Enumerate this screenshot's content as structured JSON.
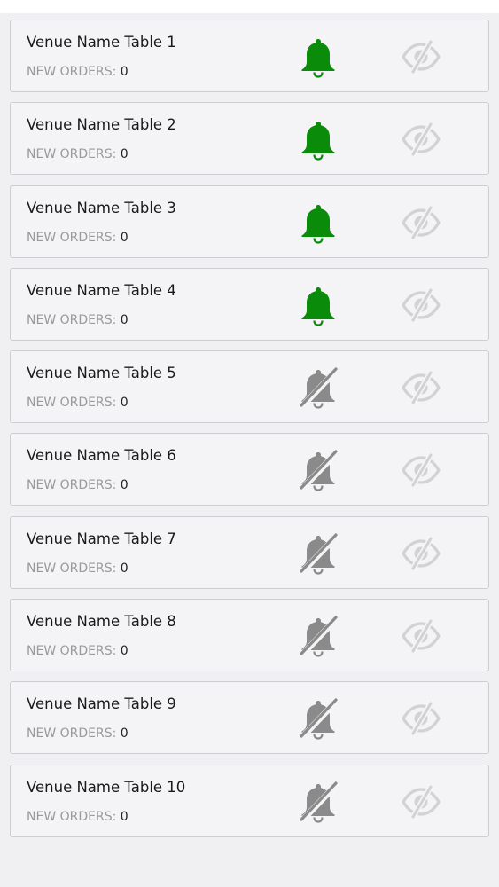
{
  "colors": {
    "bell_on": "#0a8c0a",
    "bell_off": "#8a8a8a",
    "eye": "#d2d2d2"
  },
  "venues": [
    {
      "name": "Venue Name Table 1",
      "orders_label": "NEW ORDERS:",
      "orders": "0",
      "notifications": true,
      "bell_icon": "bell-icon",
      "visibility_icon": "eye-slash-icon"
    },
    {
      "name": "Venue Name Table 2",
      "orders_label": "NEW ORDERS:",
      "orders": "0",
      "notifications": true,
      "bell_icon": "bell-icon",
      "visibility_icon": "eye-slash-icon"
    },
    {
      "name": "Venue Name Table 3",
      "orders_label": "NEW ORDERS:",
      "orders": "0",
      "notifications": true,
      "bell_icon": "bell-icon",
      "visibility_icon": "eye-slash-icon"
    },
    {
      "name": "Venue Name Table 4",
      "orders_label": "NEW ORDERS:",
      "orders": "0",
      "notifications": true,
      "bell_icon": "bell-icon",
      "visibility_icon": "eye-slash-icon"
    },
    {
      "name": "Venue Name Table 5",
      "orders_label": "NEW ORDERS:",
      "orders": "0",
      "notifications": false,
      "bell_icon": "bell-slash-icon",
      "visibility_icon": "eye-slash-icon"
    },
    {
      "name": "Venue Name Table 6",
      "orders_label": "NEW ORDERS:",
      "orders": "0",
      "notifications": false,
      "bell_icon": "bell-slash-icon",
      "visibility_icon": "eye-slash-icon"
    },
    {
      "name": "Venue Name Table 7",
      "orders_label": "NEW ORDERS:",
      "orders": "0",
      "notifications": false,
      "bell_icon": "bell-slash-icon",
      "visibility_icon": "eye-slash-icon"
    },
    {
      "name": "Venue Name Table 8",
      "orders_label": "NEW ORDERS:",
      "orders": "0",
      "notifications": false,
      "bell_icon": "bell-slash-icon",
      "visibility_icon": "eye-slash-icon"
    },
    {
      "name": "Venue Name Table 9",
      "orders_label": "NEW ORDERS:",
      "orders": "0",
      "notifications": false,
      "bell_icon": "bell-slash-icon",
      "visibility_icon": "eye-slash-icon"
    },
    {
      "name": "Venue Name Table 10",
      "orders_label": "NEW ORDERS:",
      "orders": "0",
      "notifications": false,
      "bell_icon": "bell-slash-icon",
      "visibility_icon": "eye-slash-icon"
    }
  ]
}
